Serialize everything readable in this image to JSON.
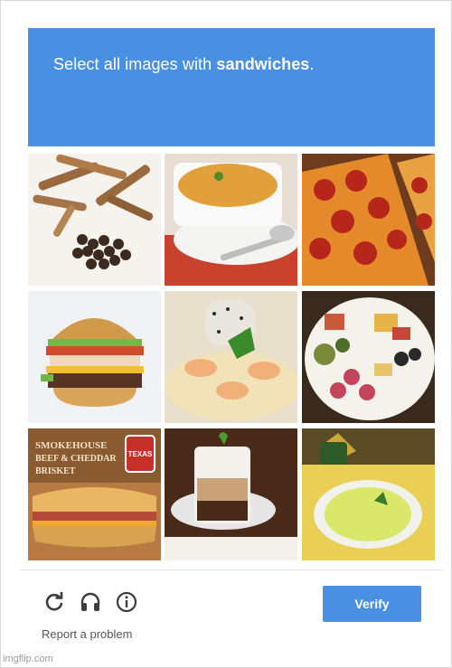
{
  "challenge": {
    "prompt_prefix": "Select all images with ",
    "prompt_target": "sandwiches",
    "prompt_suffix": "."
  },
  "tiles": [
    {
      "subject": "cinnamon sticks and spices",
      "sign_text": ""
    },
    {
      "subject": "soup bowl with spoon",
      "sign_text": ""
    },
    {
      "subject": "pepperoni pizza",
      "sign_text": ""
    },
    {
      "subject": "burger sandwich",
      "sign_text": ""
    },
    {
      "subject": "rice dish with shrimp",
      "sign_text": ""
    },
    {
      "subject": "plate of appetizers",
      "sign_text": ""
    },
    {
      "subject": "sub sandwich with sign",
      "sign_line1": "SMOKEHOUSE",
      "sign_line2": "BEEF & CHEDDAR",
      "sign_line3": "BRISKET",
      "badge": "TEXAS"
    },
    {
      "subject": "layered coffee drink",
      "sign_text": ""
    },
    {
      "subject": "guacamole dip",
      "sign_text": ""
    }
  ],
  "footer": {
    "reload_icon": "reload-icon",
    "audio_icon": "headphones-icon",
    "info_icon": "info-icon",
    "verify_label": "Verify",
    "report_label": "Report a problem"
  },
  "watermark": "imgflip.com",
  "colors": {
    "accent": "#4a90e2"
  }
}
